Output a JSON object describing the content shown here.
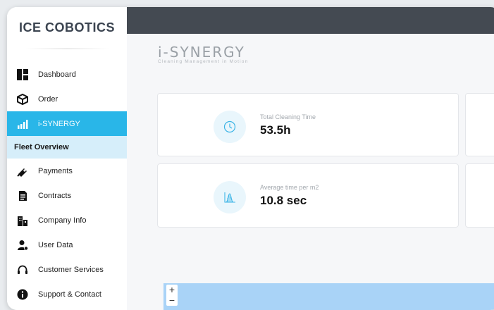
{
  "logo": {
    "text": "ICE COBOTICS"
  },
  "nav": {
    "dashboard": "Dashboard",
    "order": "Order",
    "isynergy": "i-SYNERGY",
    "fleet_overview": "Fleet Overview",
    "payments": "Payments",
    "contracts": "Contracts",
    "company_info": "Company Info",
    "user_data": "User Data",
    "customer_services": "Customer Services",
    "support_contact": "Support & Contact"
  },
  "brand": {
    "title": "i-SYNERGY",
    "tagline": "Cleaning Management in Motion"
  },
  "cards": [
    {
      "label": "Total Cleaning Time",
      "value": "53.5h",
      "icon": "clock-icon"
    },
    {
      "label": "Average time per m2",
      "value": "10.8 sec",
      "icon": "chart-icon"
    }
  ],
  "map": {
    "zoom_in": "+",
    "zoom_out": "−"
  },
  "colors": {
    "accent": "#29b6e8",
    "topbar": "#444a52",
    "subnav_bg": "#d6eefa"
  }
}
